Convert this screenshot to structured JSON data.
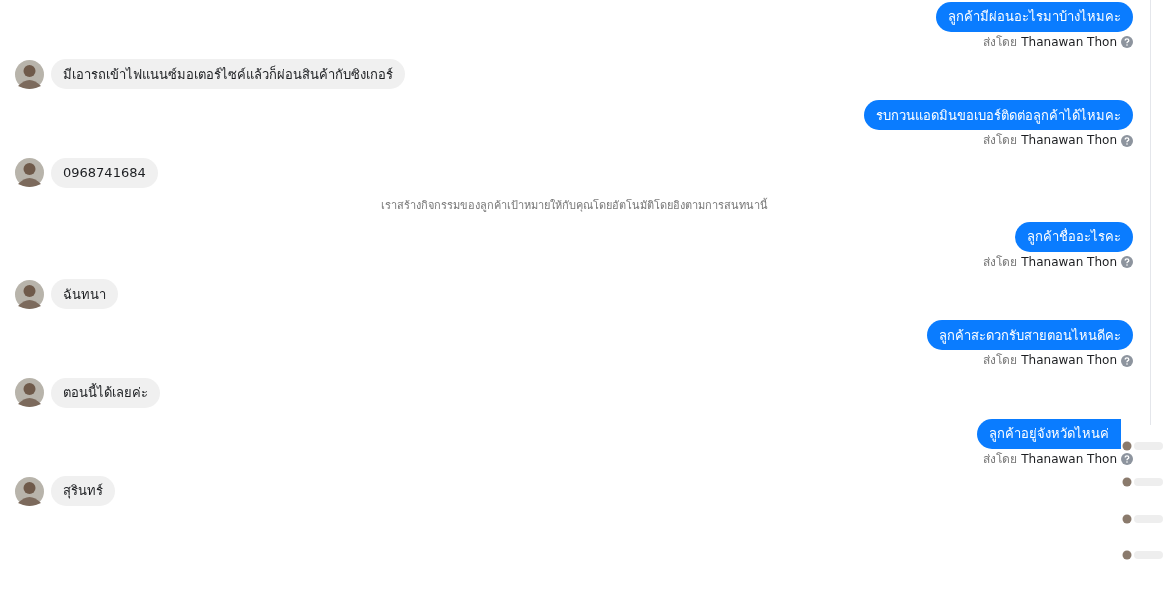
{
  "messages": [
    {
      "kind": "outgoing",
      "text": "ลูกค้ามีผ่อนอะไรมาบ้างไหมคะ",
      "sent_by_label": "ส่งโดย",
      "sender": "Thanawan Thon"
    },
    {
      "kind": "incoming",
      "text": "มีเอารถเข้าไฟแนนซ์มอเตอร์ไซค์แล้วก็ผ่อนสินค้ากับซิงเกอร์"
    },
    {
      "kind": "outgoing",
      "text": "รบกวนแอดมินขอเบอร์ติดต่อลูกค้าได้ไหมคะ",
      "sent_by_label": "ส่งโดย",
      "sender": "Thanawan Thon"
    },
    {
      "kind": "incoming",
      "text": "0968741684"
    },
    {
      "kind": "system",
      "text": "เราสร้างกิจกรรมของลูกค้าเป้าหมายให้กับคุณโดยอัตโนมัติโดยอิงตามการสนทนานี้"
    },
    {
      "kind": "outgoing",
      "text": "ลูกค้าชื่ออะไรคะ",
      "sent_by_label": "ส่งโดย",
      "sender": "Thanawan Thon"
    },
    {
      "kind": "incoming",
      "text": "ฉันทนา"
    },
    {
      "kind": "outgoing",
      "text": "ลูกค้าสะดวกรับสายตอนไหนดีคะ",
      "sent_by_label": "ส่งโดย",
      "sender": "Thanawan Thon"
    },
    {
      "kind": "incoming",
      "text": "ตอนนี้ได้เลยค่ะ"
    },
    {
      "kind": "outgoing",
      "text": "ลูกค้าอยู่จังหวัดไหนค่",
      "sent_by_label": "ส่งโดย",
      "sender": "Thanawan Thon"
    },
    {
      "kind": "incoming",
      "text": "สุรินทร์"
    }
  ]
}
